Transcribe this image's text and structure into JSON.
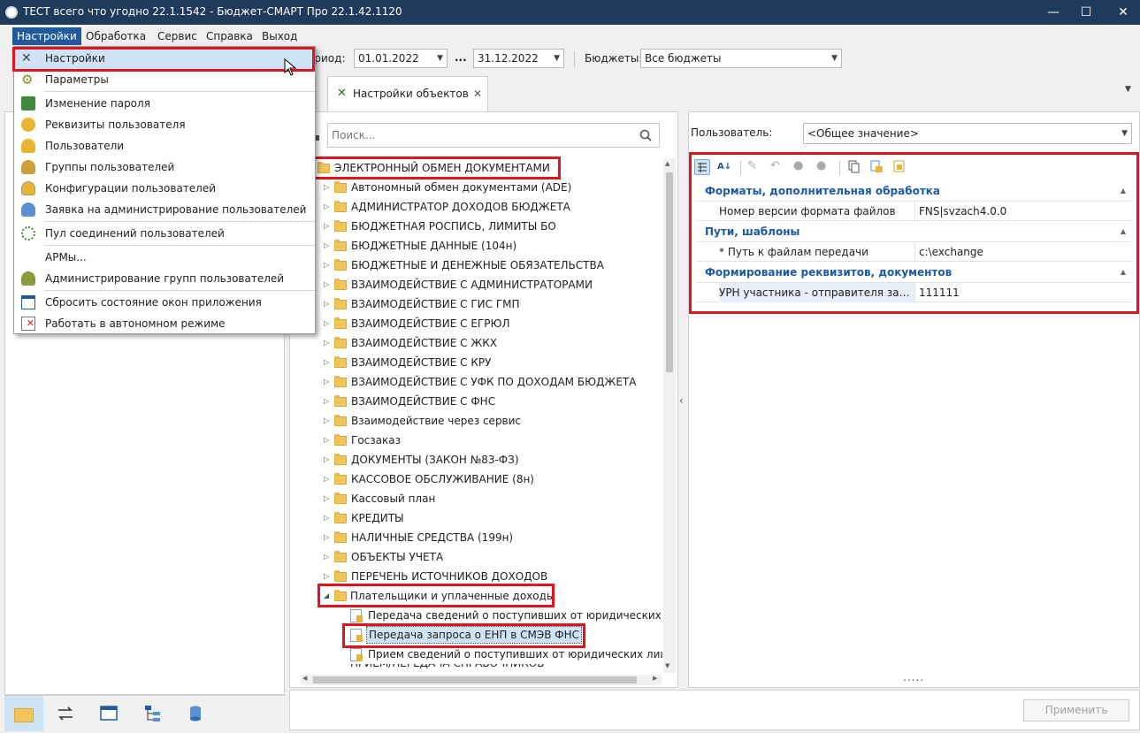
{
  "window": {
    "title": "ТЕСТ всего что угодно 22.1.1542 - Бюджет-СМАРТ Про 22.1.42.1120",
    "minimize": "—",
    "maximize": "☐",
    "close": "✕"
  },
  "menubar": {
    "items": [
      "Настройки",
      "Обработка",
      "Сервис",
      "Справка",
      "Выход"
    ]
  },
  "toolbar": {
    "period_label": "ериод:",
    "date_from": "01.01.2022",
    "date_sep": "...",
    "date_to": "31.12.2022",
    "budgets_label": "Бюджеты:",
    "budgets_value": "Все бюджеты"
  },
  "tabs": [
    {
      "label": "Настройки объектов",
      "close": "✕"
    }
  ],
  "tab_overflow": "▼",
  "dropdown_menu": {
    "items": [
      {
        "label": "Настройки",
        "icon": "tools-icon"
      },
      {
        "label": "Параметры",
        "icon": "gear-icon"
      },
      {
        "label": "Изменение пароля",
        "icon": "password-icon"
      },
      {
        "label": "Реквизиты пользователя",
        "icon": "user-info-icon"
      },
      {
        "label": "Пользователи",
        "icon": "user-icon"
      },
      {
        "label": "Группы пользователей",
        "icon": "user-group-icon"
      },
      {
        "label": "Конфигурации пользователей",
        "icon": "user-config-icon"
      },
      {
        "label": "Заявка на администрирование пользователей",
        "icon": "user-request-icon"
      },
      {
        "label": "Пул соединений пользователей",
        "icon": "connection-pool-icon"
      },
      {
        "label": "АРМы...",
        "icon": ""
      },
      {
        "label": "Администрирование групп пользователей",
        "icon": "group-admin-icon"
      },
      {
        "label": "Сбросить состояние окон приложения",
        "icon": "reset-windows-icon"
      },
      {
        "label": "Работать в автономном режиме",
        "icon": "offline-icon"
      }
    ]
  },
  "search": {
    "placeholder": "Поиск..."
  },
  "tree": {
    "root": "ЭЛЕКТРОННЫЙ ОБМЕН ДОКУМЕНТАМИ",
    "folders": [
      "Автономный обмен документами (ADE)",
      "АДМИНИСТРАТОР ДОХОДОВ БЮДЖЕТА",
      "БЮДЖЕТНАЯ РОСПИСЬ, ЛИМИТЫ БО",
      "БЮДЖЕТНЫЕ ДАННЫЕ (104н)",
      "БЮДЖЕТНЫЕ И ДЕНЕЖНЫЕ ОБЯЗАТЕЛЬСТВА",
      "ВЗАИМОДЕЙСТВИЕ С АДМИНИСТРАТОРАМИ",
      "ВЗАИМОДЕЙСТВИЕ С ГИС ГМП",
      "ВЗАИМОДЕЙСТВИЕ С ЕГРЮЛ",
      "ВЗАИМОДЕЙСТВИЕ С ЖКХ",
      "ВЗАИМОДЕЙСТВИЕ С КРУ",
      "ВЗАИМОДЕЙСТВИЕ С УФК ПО ДОХОДАМ БЮДЖЕТА",
      "ВЗАИМОДЕЙСТВИЕ С ФНС",
      "Взаимодействие через сервис",
      "Госзаказ",
      "ДОКУМЕНТЫ (ЗАКОН №83-ФЗ)",
      "КАССОВОЕ ОБСЛУЖИВАНИЕ (8н)",
      "Кассовый план",
      "КРЕДИТЫ",
      "НАЛИЧНЫЕ СРЕДСТВА (199н)",
      "ОБЪЕКТЫ УЧЕТА",
      "ПЕРЕЧЕНЬ ИСТОЧНИКОВ ДОХОДОВ"
    ],
    "expanded_folder": "Плательщики и уплаченные доходы",
    "children": [
      "Передача сведений о поступивших от юридических л",
      "Передача запроса о ЕНП в СМЭВ ФНС",
      "Прием сведений о поступивших от юридических лиц"
    ],
    "cutoff_row": "ПРИЕМ/ПЕРЕДАЧА СПРАВОЧНИКОВ"
  },
  "properties": {
    "user_label": "Пользователь:",
    "user_value": "<Общее значение>",
    "categories": [
      {
        "title": "Форматы, дополнительная обработка",
        "rows": [
          {
            "name": "Номер версии формата файлов",
            "value": "FNS|svzach4.0.0"
          }
        ]
      },
      {
        "title": "Пути, шаблоны",
        "rows": [
          {
            "name": "* Путь к файлам передачи",
            "value": "c:\\exchange"
          }
        ]
      },
      {
        "title": "Формирование реквизитов, документов",
        "rows": [
          {
            "name": "УРН участника - отправителя запр...",
            "value": "111111"
          }
        ]
      }
    ],
    "dots": "....."
  },
  "apply_button": "Применить",
  "colors": {
    "titlebar": "#1f3a5b",
    "accent": "#1f5a9e",
    "highlight": "#e0161c",
    "category": "#1a5aa6"
  }
}
